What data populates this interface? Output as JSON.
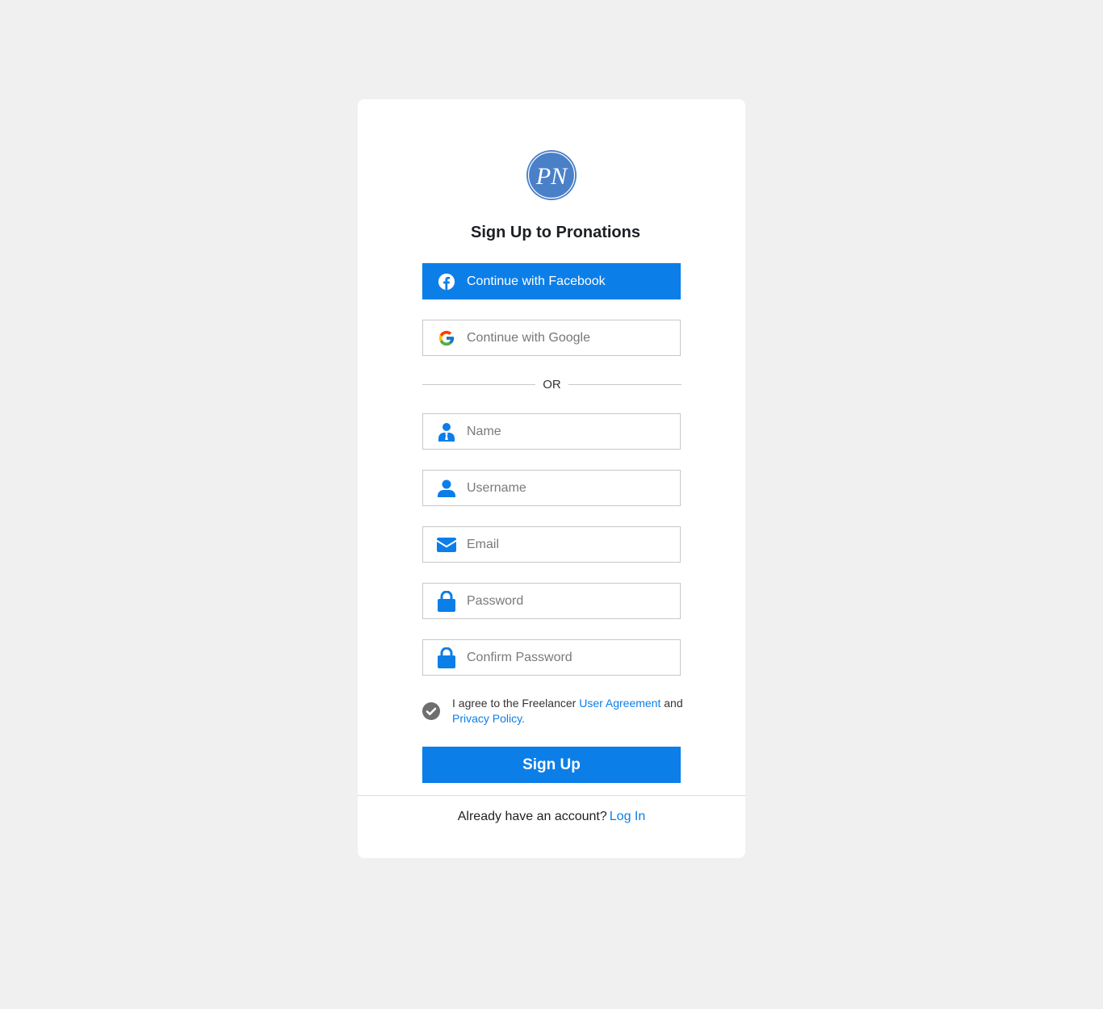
{
  "brand": {
    "logo_text": "PN",
    "logo_color": "#4a80c8"
  },
  "title": "Sign Up to Pronations",
  "social": {
    "facebook_label": "Continue with Facebook",
    "google_label": "Continue with Google"
  },
  "separator": "OR",
  "fields": {
    "name_placeholder": "Name",
    "username_placeholder": "Username",
    "email_placeholder": "Email",
    "password_placeholder": "Password",
    "confirm_password_placeholder": "Confirm Password"
  },
  "agreement": {
    "prefix": "I agree to the Freelancer ",
    "user_agreement": "User Agreement",
    "conjunction": " and ",
    "privacy_policy": "Privacy Policy",
    "suffix": ".",
    "checked": true
  },
  "signup_button": "Sign Up",
  "footer": {
    "prompt": "Already have an account?",
    "login_link": "Log In"
  },
  "colors": {
    "accent": "#0c7ee8",
    "background": "#f0f0f0",
    "card": "#ffffff"
  }
}
